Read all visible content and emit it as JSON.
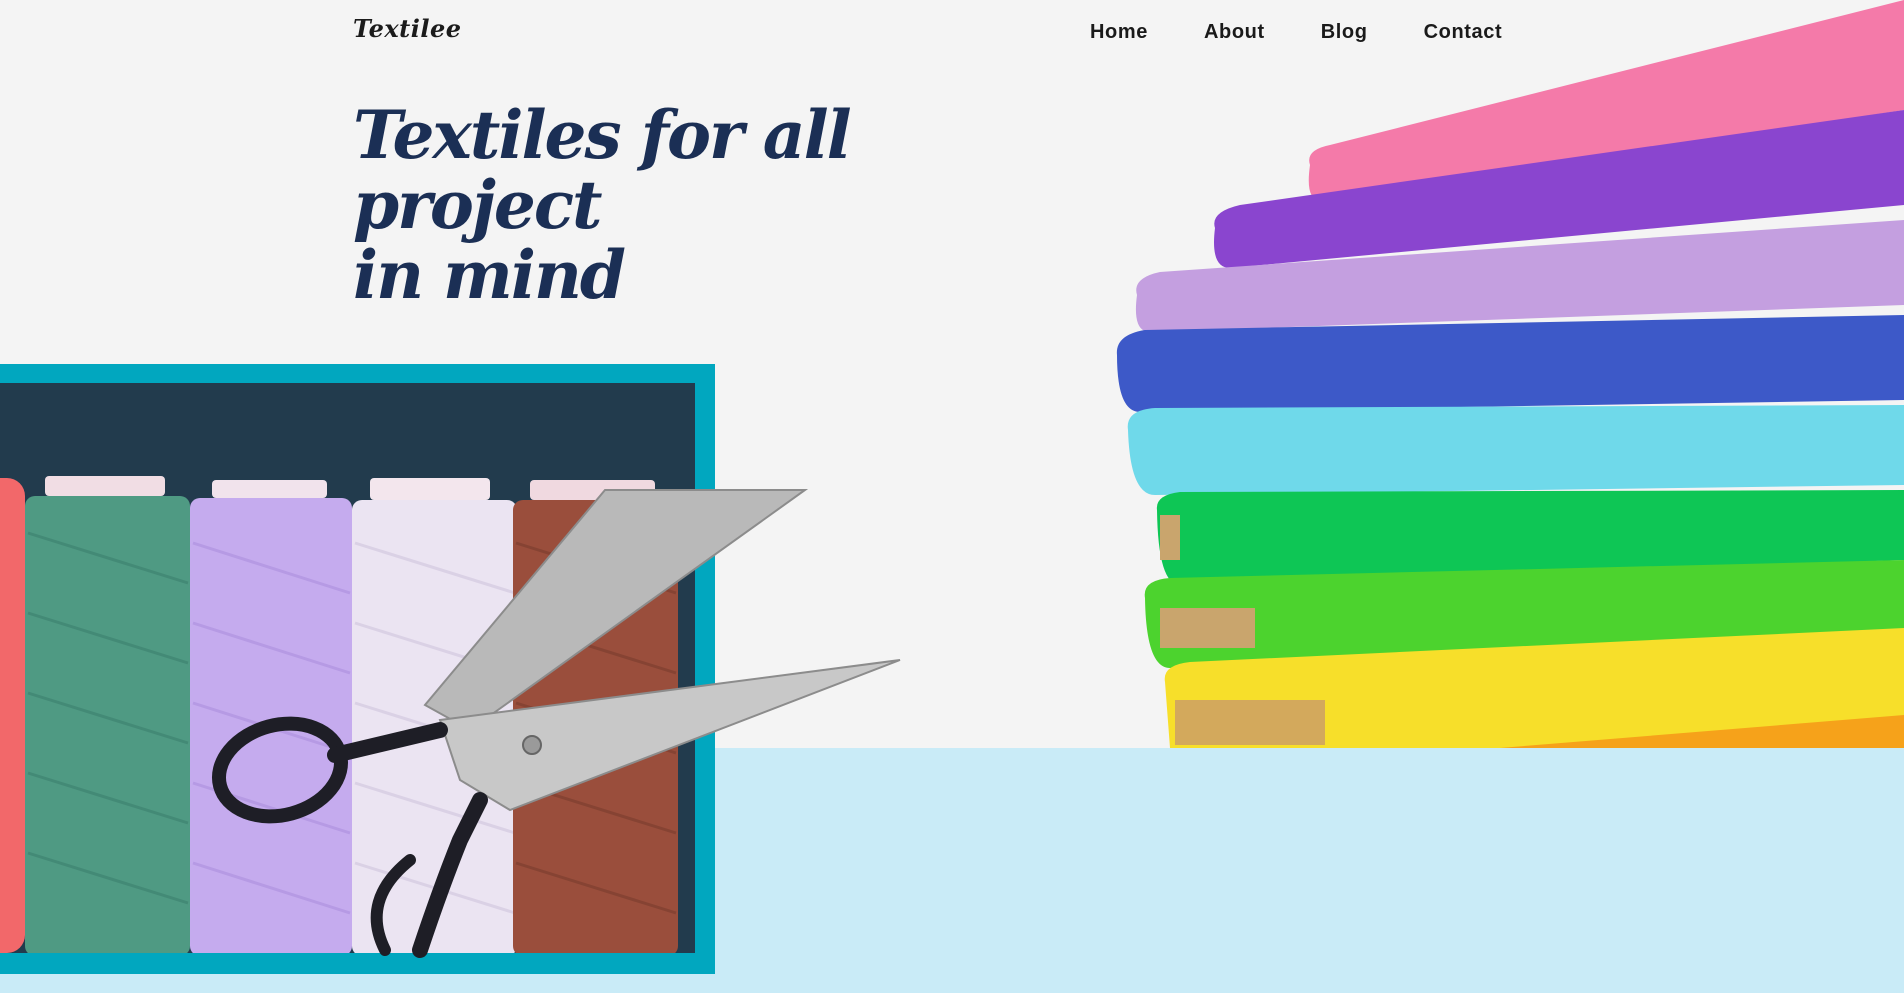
{
  "header": {
    "logo": "Textilee",
    "nav": [
      {
        "label": "Home"
      },
      {
        "label": "About"
      },
      {
        "label": "Blog"
      },
      {
        "label": "Contact"
      }
    ]
  },
  "hero": {
    "title_line1": "Textiles for all project",
    "title_line2": "in mind"
  },
  "colors": {
    "background": "#f4f4f4",
    "bottom_band": "#c9ebf7",
    "frame": "#01a7bf",
    "photo_bg": "#223b4d",
    "title": "#1b2f55"
  },
  "images": {
    "thread_photo": "thread-spools-with-scissors",
    "fabric_photo": "stack-of-rainbow-fabric-bolts"
  }
}
